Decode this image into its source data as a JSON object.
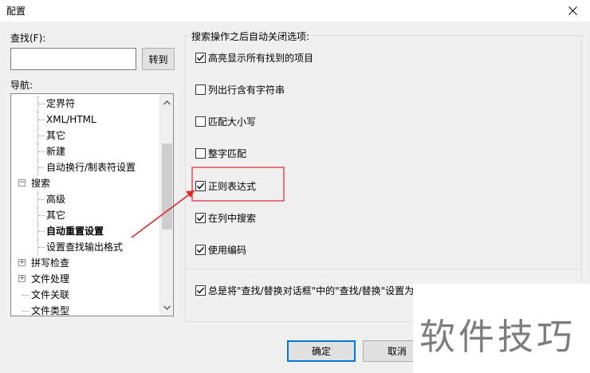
{
  "window": {
    "title": "配置"
  },
  "left": {
    "find_label": "查找(F):",
    "find_value": "",
    "goto_button": "转到",
    "nav_label": "导航:",
    "tree": [
      {
        "label": "定界符",
        "level": 1,
        "bold": false
      },
      {
        "label": "XML/HTML",
        "level": 1,
        "bold": false
      },
      {
        "label": "其它",
        "level": 1,
        "bold": false
      },
      {
        "label": "新建",
        "level": 1,
        "bold": false
      },
      {
        "label": "自动换行/制表符设置",
        "level": 1,
        "bold": false
      },
      {
        "label": "搜索",
        "level": 0,
        "bold": false,
        "expander": "−"
      },
      {
        "label": "高级",
        "level": 1,
        "bold": false
      },
      {
        "label": "其它",
        "level": 1,
        "bold": false
      },
      {
        "label": "自动重置设置",
        "level": 1,
        "bold": true
      },
      {
        "label": "设置查找输出格式",
        "level": 1,
        "bold": false
      },
      {
        "label": "拼写检查",
        "level": 0,
        "bold": false,
        "expander": "+"
      },
      {
        "label": "文件处理",
        "level": 0,
        "bold": false,
        "expander": "+"
      },
      {
        "label": "文件关联",
        "level": 0,
        "bold": false
      },
      {
        "label": "文件类型",
        "level": 0,
        "bold": false
      }
    ]
  },
  "right": {
    "group_title": "搜索操作之后自动关闭选项:",
    "options": [
      {
        "label": "高亮显示所有找到的项目",
        "checked": true
      },
      {
        "label": "列出行含有字符串",
        "checked": false
      },
      {
        "label": "匹配大小写",
        "checked": false
      },
      {
        "label": "整字匹配",
        "checked": false
      },
      {
        "label": "正则表达式",
        "checked": true
      },
      {
        "label": "在列中搜索",
        "checked": true
      },
      {
        "label": "使用编码",
        "checked": true
      }
    ],
    "bottom_option": {
      "label": "总是将\"查找/替换对话框\"中的\"查找/替换\"设置为",
      "checked": true
    }
  },
  "buttons": {
    "ok": "确定",
    "cancel": "取消"
  },
  "watermark": "软件技巧",
  "colors": {
    "annotation": "#e0262b",
    "dialog_bg": "#f0f0f0",
    "default_button_border": "#0078d7"
  }
}
